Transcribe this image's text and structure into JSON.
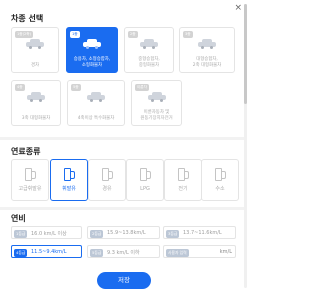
{
  "sections": {
    "vehicle_type": "차종 선택",
    "fuel_type": "연료종류",
    "efficiency": "연비"
  },
  "vehicle_types": [
    {
      "badge": "1종(2축)",
      "label": "경차",
      "selected": false
    },
    {
      "badge": "1종",
      "label": "승용차, 소형승합차,\n소형화물차",
      "selected": true
    },
    {
      "badge": "2종",
      "label": "중형승합차,\n중형화물차",
      "selected": false
    },
    {
      "badge": "3종",
      "label": "대형승합차,\n2축 대형화물차",
      "selected": false
    },
    {
      "badge": "4종",
      "label": "3축 대형화물차",
      "selected": false
    },
    {
      "badge": "5종",
      "label": "4축이상 특수화물차",
      "selected": false
    },
    {
      "badge": "이륜차",
      "label": "이륜자동차 및\n원동기장치자전거",
      "selected": false
    }
  ],
  "fuels": [
    {
      "label": "고급휘발유",
      "selected": false
    },
    {
      "label": "휘발유",
      "selected": true
    },
    {
      "label": "경유",
      "selected": false
    },
    {
      "label": "LPG",
      "selected": false
    },
    {
      "label": "전기",
      "selected": false
    },
    {
      "label": "수소",
      "selected": false
    }
  ],
  "efficiency_options": [
    {
      "badge": "1등급",
      "range": "16.0 km/L 이상",
      "selected": false
    },
    {
      "badge": "2등급",
      "range": "15.9~13.8km/L",
      "selected": false
    },
    {
      "badge": "3등급",
      "range": "13.7~11.6km/L",
      "selected": false
    },
    {
      "badge": "4등급",
      "range": "11.5~9.4km/L",
      "selected": true
    },
    {
      "badge": "5등급",
      "range": "9.3 km/L 이하",
      "selected": false
    }
  ],
  "custom_efficiency": {
    "badge": "사용자 입력",
    "unit": "km/L"
  },
  "save_label": "저장",
  "close_glyph": "×",
  "accent_color": "#1a6cf0"
}
